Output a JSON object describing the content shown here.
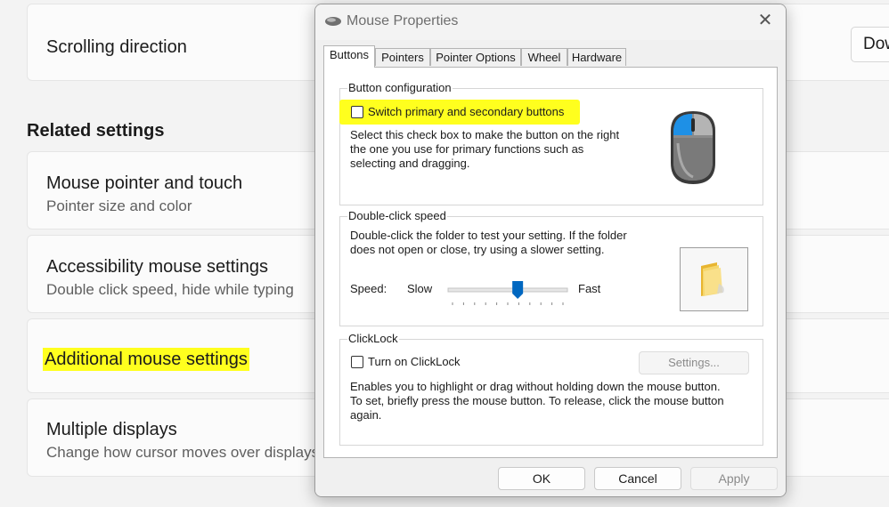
{
  "settings": {
    "scrolling_direction": "Scrolling direction",
    "scrolling_dropdown_value": "Down",
    "related_heading": "Related settings",
    "items": [
      {
        "title": "Mouse pointer and touch",
        "subtitle": "Pointer size and color"
      },
      {
        "title": "Accessibility mouse settings",
        "subtitle": "Double click speed, hide while typing"
      },
      {
        "title": "Additional mouse settings",
        "subtitle": ""
      },
      {
        "title": "Multiple displays",
        "subtitle": "Change how cursor moves over displays"
      }
    ]
  },
  "dialog": {
    "title": "Mouse Properties",
    "close_glyph": "✕",
    "tabs": [
      "Buttons",
      "Pointers",
      "Pointer Options",
      "Wheel",
      "Hardware"
    ],
    "button_config": {
      "label": "Button configuration",
      "checkbox_label": "Switch primary and secondary buttons",
      "description": [
        "Select this check box to make the button on the right",
        "the one you use for primary functions such as",
        "selecting and dragging."
      ]
    },
    "double_click": {
      "label": "Double-click speed",
      "description": [
        "Double-click the folder to test your setting. If the folder",
        "does not open or close, try using a slower setting."
      ],
      "speed_label": "Speed:",
      "slow_label": "Slow",
      "fast_label": "Fast",
      "speed_value_fraction": 0.59
    },
    "clicklock": {
      "label": "ClickLock",
      "checkbox_label": "Turn on ClickLock",
      "settings_button": "Settings...",
      "description": [
        "Enables you to highlight or drag without holding down the mouse button.",
        "To set, briefly press the mouse button. To release, click the mouse button",
        "again."
      ]
    },
    "buttons": {
      "ok": "OK",
      "cancel": "Cancel",
      "apply": "Apply"
    }
  },
  "colors": {
    "highlight": "#ffff1e",
    "slider_thumb": "#0067c0",
    "mouse_accent": "#1e90e6"
  },
  "icons": [
    "mouse-app-icon",
    "close-icon",
    "mouse-icon",
    "folder-icon"
  ]
}
